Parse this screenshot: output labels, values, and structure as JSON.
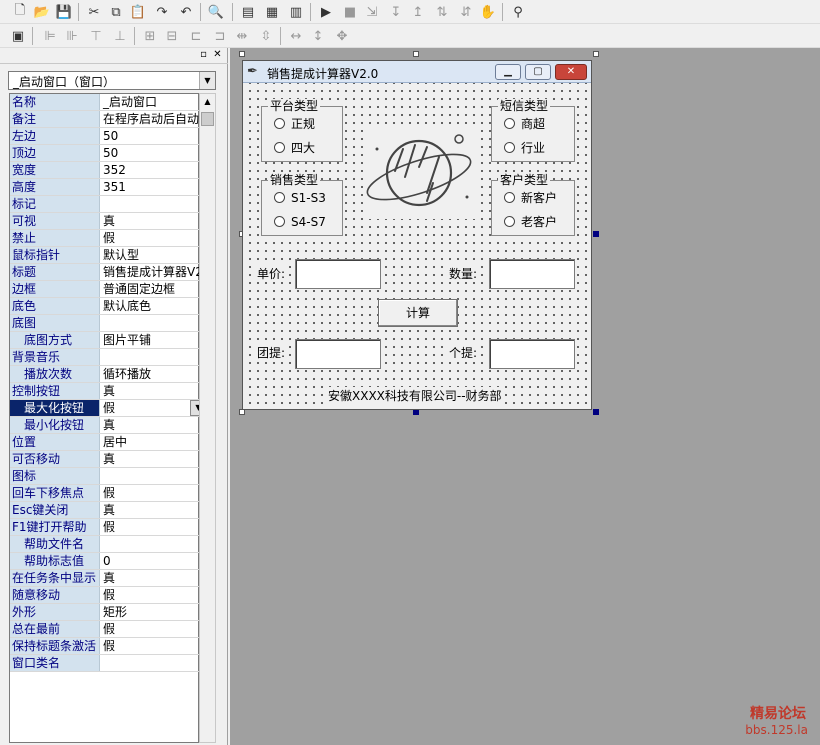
{
  "left_panel": {
    "combo_value": "_启动窗口（窗口）",
    "properties": [
      {
        "name": "名称",
        "value": "_启动窗口"
      },
      {
        "name": "备注",
        "value": "在程序启动后自动"
      },
      {
        "name": "左边",
        "value": "50"
      },
      {
        "name": "顶边",
        "value": "50"
      },
      {
        "name": "宽度",
        "value": "352"
      },
      {
        "name": "高度",
        "value": "351"
      },
      {
        "name": "标记",
        "value": ""
      },
      {
        "name": "可视",
        "value": "真"
      },
      {
        "name": "禁止",
        "value": "假"
      },
      {
        "name": "鼠标指针",
        "value": "默认型"
      },
      {
        "name": "标题",
        "value": "销售提成计算器V2"
      },
      {
        "name": "边框",
        "value": "普通固定边框"
      },
      {
        "name": "底色",
        "value": "默认底色"
      },
      {
        "name": "底图",
        "value": ""
      },
      {
        "name": "底图方式",
        "value": "图片平铺",
        "sub": true
      },
      {
        "name": "背景音乐",
        "value": ""
      },
      {
        "name": "播放次数",
        "value": "循环播放",
        "sub": true
      },
      {
        "name": "控制按钮",
        "value": "真"
      },
      {
        "name": "最大化按钮",
        "value": "假",
        "sub": true,
        "selected": true
      },
      {
        "name": "最小化按钮",
        "value": "真",
        "sub": true
      },
      {
        "name": "位置",
        "value": "居中"
      },
      {
        "name": "可否移动",
        "value": "真"
      },
      {
        "name": "图标",
        "value": ""
      },
      {
        "name": "回车下移焦点",
        "value": "假"
      },
      {
        "name": "Esc键关闭",
        "value": "真"
      },
      {
        "name": "F1键打开帮助",
        "value": "假"
      },
      {
        "name": "帮助文件名",
        "value": "",
        "sub": true
      },
      {
        "name": "帮助标志值",
        "value": "0",
        "sub": true
      },
      {
        "name": "在任务条中显示",
        "value": "真"
      },
      {
        "name": "随意移动",
        "value": "假"
      },
      {
        "name": "外形",
        "value": "矩形"
      },
      {
        "name": "总在最前",
        "value": "假"
      },
      {
        "name": "保持标题条激活",
        "value": "假"
      },
      {
        "name": "窗口类名",
        "value": ""
      }
    ]
  },
  "dialog": {
    "title": "销售提成计算器V2.0",
    "group_platform": {
      "label": "平台类型",
      "options": [
        "正规",
        "四大"
      ]
    },
    "group_sms": {
      "label": "短信类型",
      "options": [
        "商超",
        "行业"
      ]
    },
    "group_sales": {
      "label": "销售类型",
      "options": [
        "S1-S3",
        "S4-S7"
      ]
    },
    "group_customer": {
      "label": "客户类型",
      "options": [
        "新客户",
        "老客户"
      ]
    },
    "unit_price_label": "单价:",
    "quantity_label": "数量:",
    "calc_button": "计算",
    "team_label": "团提:",
    "personal_label": "个提:",
    "footer": "安徽XXXX科技有限公司--财务部"
  },
  "watermark": {
    "line1": "精易论坛",
    "line2": "bbs.125.la"
  }
}
